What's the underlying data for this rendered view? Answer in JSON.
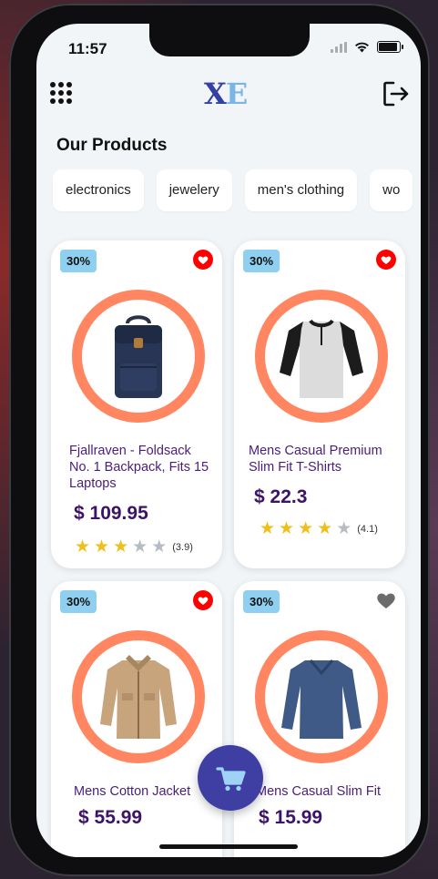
{
  "status_bar": {
    "time": "11:57"
  },
  "header": {
    "logo_left": "X",
    "logo_right": "E",
    "menu_icon": "grid-menu-icon",
    "logout_icon": "logout-icon"
  },
  "page_title": "Our Products",
  "categories": [
    "electronics",
    "jewelery",
    "men's clothing",
    "wo"
  ],
  "products": [
    {
      "name": "Fjallraven - Foldsack No. 1 Backpack, Fits 15 Laptops",
      "price": "$ 109.95",
      "discount": "30%",
      "rating": 3,
      "rating_label": "(3.9)",
      "favorite": true,
      "image": "backpack"
    },
    {
      "name": "Mens Casual Premium Slim Fit T-Shirts",
      "price": "$ 22.3",
      "discount": "30%",
      "rating": 4,
      "rating_label": "(4.1)",
      "favorite": true,
      "image": "henley-shirt"
    },
    {
      "name": "Mens Cotton Jacket",
      "price": "$ 55.99",
      "discount": "30%",
      "rating": 0,
      "rating_label": "",
      "favorite": true,
      "image": "cotton-jacket"
    },
    {
      "name": "Mens Casual Slim Fit",
      "price": "$ 15.99",
      "discount": "30%",
      "rating": 0,
      "rating_label": "",
      "favorite": false,
      "image": "long-sleeve-shirt"
    }
  ],
  "fab": {
    "icon": "cart-icon"
  },
  "colors": {
    "accent": "#3e3ea3",
    "ring": "#ff8660",
    "badge": "#8fd0f0",
    "favorite": "#ff0000",
    "product_text": "#4a1d7a"
  }
}
